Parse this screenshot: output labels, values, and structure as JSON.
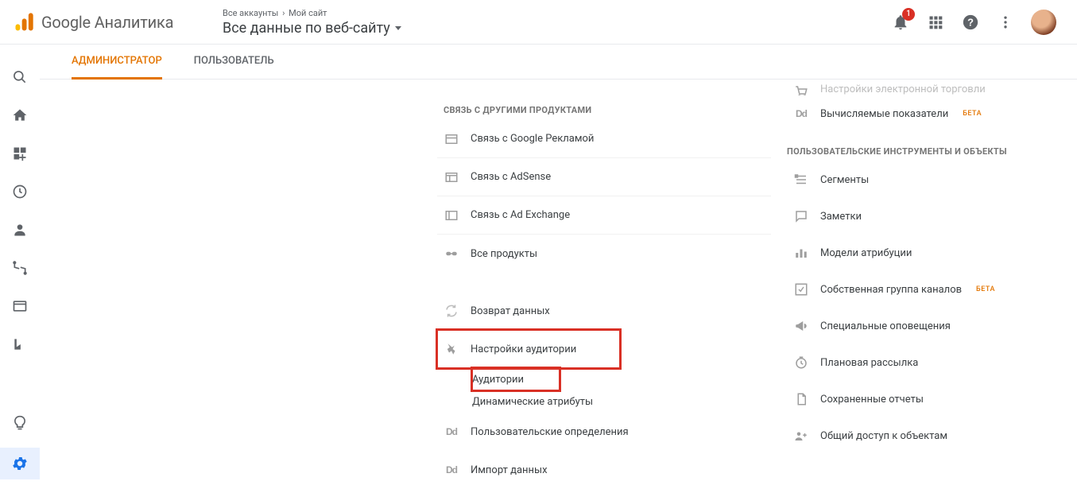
{
  "header": {
    "product_name": "Google Аналитика",
    "breadcrumb_prefix": "Все аккаунты",
    "breadcrumb_current": "Мой сайт",
    "view_title": "Все данные по веб-сайту",
    "notification_count": "1"
  },
  "tabs": {
    "admin": "АДМИНИСТРАТОР",
    "user": "ПОЛЬЗОВАТЕЛЬ"
  },
  "middle": {
    "heading_links": "СВЯЗЬ С ДРУГИМИ ПРОДУКТАМИ",
    "item_ads": "Связь с Google Рекламой",
    "item_adsense": "Связь с AdSense",
    "item_adexchange": "Связь с Ad Exchange",
    "item_all_products": "Все продукты",
    "item_data_return": "Возврат данных",
    "item_audience_settings": "Настройки аудитории",
    "sub_audiences": "Аудитории",
    "sub_dynamic_attrs": "Динамические атрибуты",
    "item_custom_defs": "Пользовательские определения",
    "item_data_import": "Импорт данных"
  },
  "right": {
    "cutoff_item": "Настройки электронной торговли",
    "item_calc_metrics": "Вычисляемые показатели",
    "beta_label": "БЕТА",
    "heading_tools": "ПОЛЬЗОВАТЕЛЬСКИЕ ИНСТРУМЕНТЫ И ОБЪЕКТЫ",
    "item_segments": "Сегменты",
    "item_notes": "Заметки",
    "item_attribution": "Модели атрибуции",
    "item_channel_group": "Собственная группа каналов",
    "item_alerts": "Специальные оповещения",
    "item_scheduled_mail": "Плановая рассылка",
    "item_saved_reports": "Сохраненные отчеты",
    "item_shared_access": "Общий доступ к объектам"
  }
}
